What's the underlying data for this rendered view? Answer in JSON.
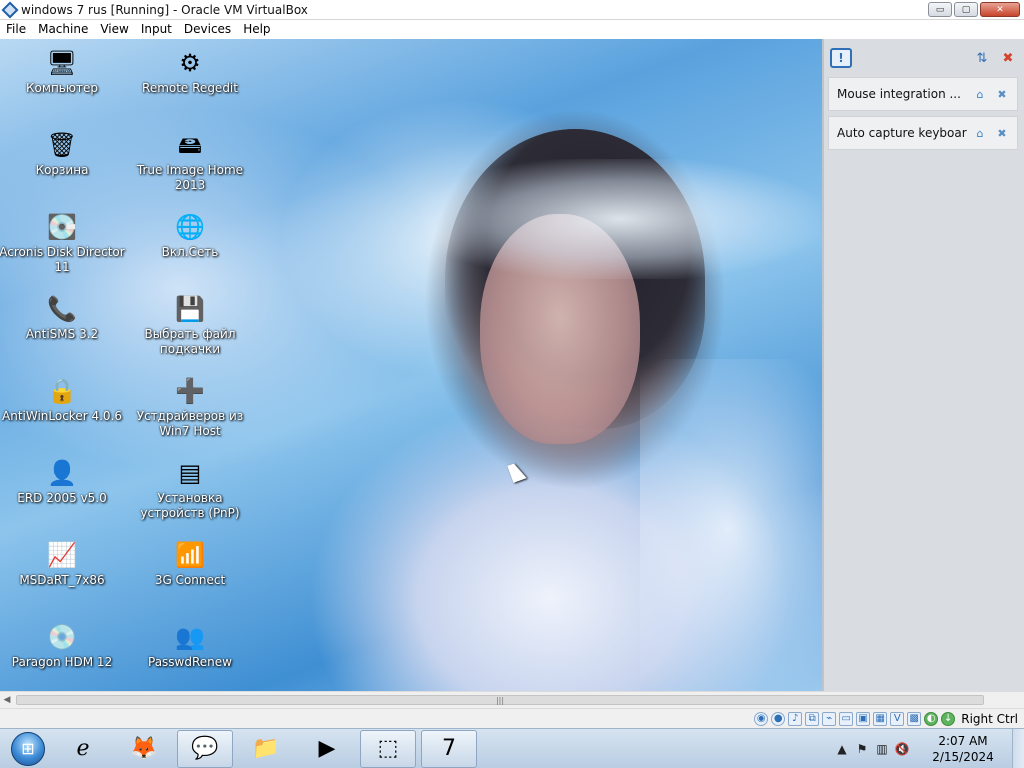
{
  "window": {
    "title": "windows 7 rus [Running] - Oracle VM VirtualBox",
    "minimize_glyph": "▭",
    "maximize_glyph": "▢",
    "close_glyph": "✕"
  },
  "menu": [
    "File",
    "Machine",
    "View",
    "Input",
    "Devices",
    "Help"
  ],
  "desktop_icons": [
    {
      "label": "Компьютер",
      "icon": "computer-icon",
      "glyph": "🖥"
    },
    {
      "label": "Корзина",
      "icon": "recycle-bin-icon",
      "glyph": "🗑"
    },
    {
      "label": "Acronis Disk Director 11",
      "icon": "acronis-disk-director-icon",
      "glyph": "💽"
    },
    {
      "label": "AntiSMS 3.2",
      "icon": "antisms-icon",
      "glyph": "📞"
    },
    {
      "label": "AntiWinLocker 4.0.6",
      "icon": "antiwinlocker-icon",
      "glyph": "🔒"
    },
    {
      "label": "ERD 2005 v5.0",
      "icon": "erd-commander-icon",
      "glyph": "👤"
    },
    {
      "label": "MSDaRT_7x86",
      "icon": "msdart-icon",
      "glyph": "📈"
    },
    {
      "label": "Paragon HDM 12",
      "icon": "paragon-hdm-icon",
      "glyph": "💿"
    },
    {
      "label": "Remote Regedit",
      "icon": "remote-regedit-icon",
      "glyph": "⚙"
    },
    {
      "label": "True Image Home 2013",
      "icon": "true-image-icon",
      "glyph": "🖴"
    },
    {
      "label": "Вкл.Сеть",
      "icon": "network-icon",
      "glyph": "🌐"
    },
    {
      "label": "Выбрать файл подкачки",
      "icon": "pagefile-icon",
      "glyph": "💾"
    },
    {
      "label": "Устдрайверов из Win7 Host",
      "icon": "driver-install-icon",
      "glyph": "➕"
    },
    {
      "label": "Установка устройств (PnP)",
      "icon": "pnp-device-icon",
      "glyph": "▤"
    },
    {
      "label": "3G Connect",
      "icon": "3g-modem-icon",
      "glyph": "📶"
    },
    {
      "label": "PasswdRenew",
      "icon": "passwd-renew-icon",
      "glyph": "👥"
    }
  ],
  "notification_panel": {
    "info_glyph": "!",
    "sort_glyph": "⇅",
    "dismiss_all_glyph": "✖",
    "items": [
      {
        "text": "Mouse integration ...",
        "help_glyph": "⌂",
        "close_glyph": "✖"
      },
      {
        "text": "Auto capture keyboard ...",
        "help_glyph": "⌂",
        "close_glyph": "✖"
      }
    ]
  },
  "scrollbar": {
    "left_arrow": "◀",
    "right_arrow": "▶",
    "thumb_grip": "|||"
  },
  "status_bar": {
    "icons": [
      {
        "name": "hard-disk-status-icon",
        "glyph": "◉"
      },
      {
        "name": "optical-drive-status-icon",
        "glyph": "●"
      },
      {
        "name": "audio-status-icon",
        "glyph": "♪"
      },
      {
        "name": "network-status-icon",
        "glyph": "⧉"
      },
      {
        "name": "usb-status-icon",
        "glyph": "⌁"
      },
      {
        "name": "shared-folders-status-icon",
        "glyph": "▭"
      },
      {
        "name": "display-status-icon",
        "glyph": "▣"
      },
      {
        "name": "recording-status-icon",
        "glyph": "▦"
      },
      {
        "name": "capture-status-icon",
        "glyph": "V"
      },
      {
        "name": "cpu-status-icon",
        "glyph": "▩"
      },
      {
        "name": "guest-additions-status-icon",
        "glyph": "◐"
      },
      {
        "name": "arrow-down-status-icon",
        "glyph": "↓"
      }
    ],
    "host_key": "Right Ctrl"
  },
  "taskbar": {
    "start_glyph": "⊞",
    "apps": [
      {
        "name": "taskbar-internet-explorer",
        "icon": "internet-explorer-icon",
        "glyph": "ℯ"
      },
      {
        "name": "taskbar-firefox",
        "icon": "firefox-icon",
        "glyph": "🦊"
      },
      {
        "name": "taskbar-chat-app",
        "icon": "chat-app-icon",
        "glyph": "💬"
      },
      {
        "name": "taskbar-file-explorer",
        "icon": "folder-icon",
        "glyph": "📁"
      },
      {
        "name": "taskbar-media-player",
        "icon": "media-player-icon",
        "glyph": "▶"
      },
      {
        "name": "taskbar-virtualbox",
        "icon": "virtualbox-icon",
        "glyph": "⬚"
      },
      {
        "name": "taskbar-windows7-vm",
        "icon": "windows7-vm-icon",
        "glyph": "7"
      }
    ],
    "tray": [
      {
        "name": "tray-show-hidden-icon",
        "glyph": "▲"
      },
      {
        "name": "tray-action-center-flag-icon",
        "glyph": "⚑"
      },
      {
        "name": "tray-network-icon",
        "glyph": "▥"
      },
      {
        "name": "tray-volume-muted-icon",
        "glyph": "🔇"
      }
    ],
    "time": "2:07 AM",
    "date": "2/15/2024"
  },
  "colors": {
    "vbox_blue": "#2f6fb5",
    "taskbar_top": "#d6e3f0",
    "close_red": "#c7452c"
  }
}
